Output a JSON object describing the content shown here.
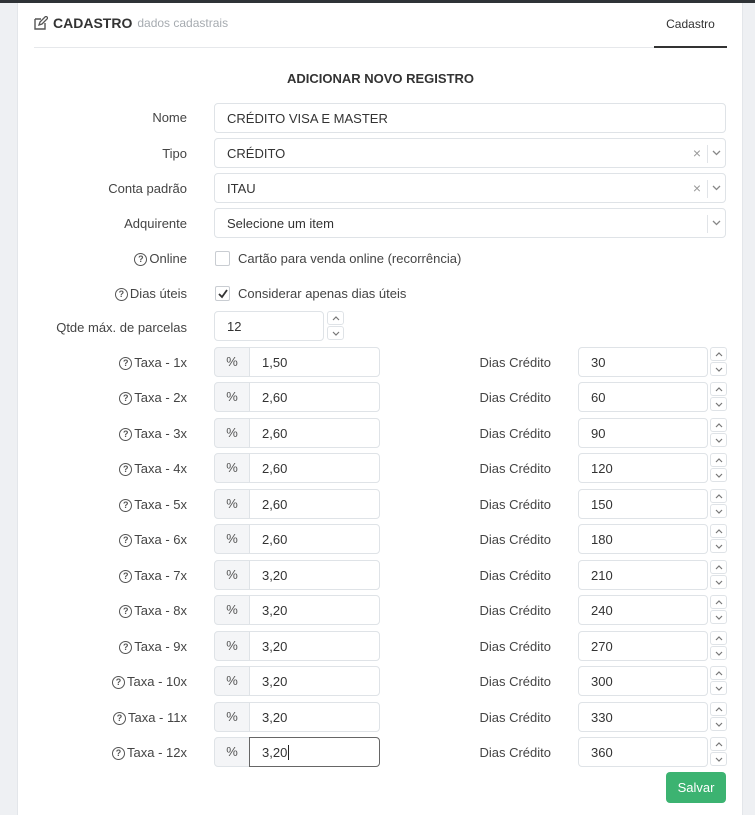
{
  "header": {
    "title": "CADASTRO",
    "subtitle": "dados cadastrais",
    "tab": "Cadastro"
  },
  "form_title": "ADICIONAR NOVO REGISTRO",
  "fields": {
    "nome": {
      "label": "Nome",
      "value": "CRÉDITO VISA E MASTER"
    },
    "tipo": {
      "label": "Tipo",
      "value": "CRÉDITO"
    },
    "conta": {
      "label": "Conta padrão",
      "value": "ITAU"
    },
    "adquirente": {
      "label": "Adquirente",
      "placeholder": "Selecione um item"
    },
    "online": {
      "label": "Online",
      "checkbox_label": "Cartão para venda online (recorrência)",
      "checked": false
    },
    "dias_uteis": {
      "label": "Dias úteis",
      "checkbox_label": "Considerar apenas dias úteis",
      "checked": true
    },
    "parcelas": {
      "label": "Qtde máx. de parcelas",
      "value": "12"
    }
  },
  "percent_symbol": "%",
  "dias_label": "Dias Crédito",
  "taxas": [
    {
      "label": "Taxa - 1x",
      "rate": "1,50",
      "dias": "30"
    },
    {
      "label": "Taxa - 2x",
      "rate": "2,60",
      "dias": "60"
    },
    {
      "label": "Taxa - 3x",
      "rate": "2,60",
      "dias": "90"
    },
    {
      "label": "Taxa - 4x",
      "rate": "2,60",
      "dias": "120"
    },
    {
      "label": "Taxa - 5x",
      "rate": "2,60",
      "dias": "150"
    },
    {
      "label": "Taxa - 6x",
      "rate": "2,60",
      "dias": "180"
    },
    {
      "label": "Taxa - 7x",
      "rate": "3,20",
      "dias": "210"
    },
    {
      "label": "Taxa - 8x",
      "rate": "3,20",
      "dias": "240"
    },
    {
      "label": "Taxa - 9x",
      "rate": "3,20",
      "dias": "270"
    },
    {
      "label": "Taxa - 10x",
      "rate": "3,20",
      "dias": "300"
    },
    {
      "label": "Taxa - 11x",
      "rate": "3,20",
      "dias": "330"
    },
    {
      "label": "Taxa - 12x",
      "rate": "3,20",
      "dias": "360"
    }
  ],
  "save_label": "Salvar",
  "colors": {
    "save": "#3cb371",
    "tab_underline": "#333333",
    "topbar": "#2f3337"
  }
}
